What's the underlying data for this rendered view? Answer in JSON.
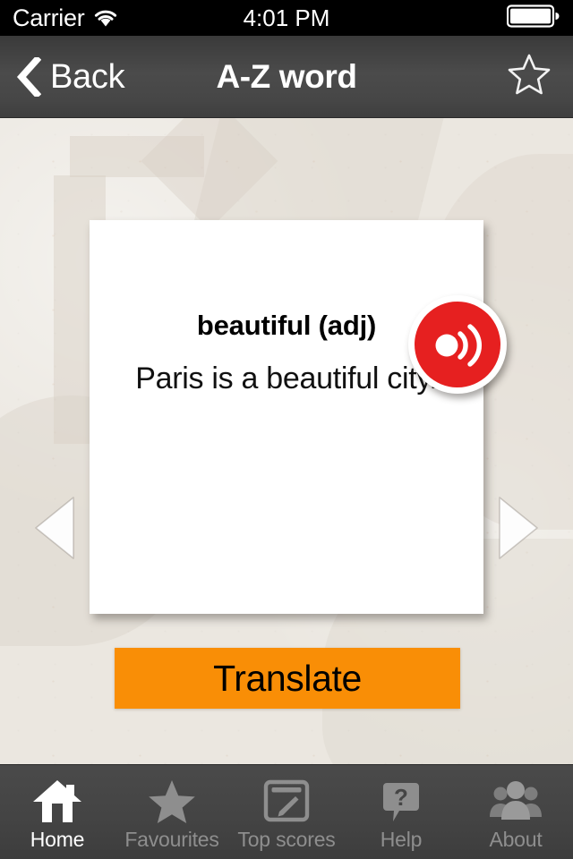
{
  "status_bar": {
    "carrier": "Carrier",
    "wifi_icon": "wifi-icon",
    "time": "4:01 PM",
    "battery_icon": "battery-icon"
  },
  "nav_bar": {
    "back_label": "Back",
    "back_icon": "chevron-left-icon",
    "title": "A-Z word",
    "favourite_icon": "star-outline-icon"
  },
  "card": {
    "word": "beautiful (adj)",
    "sentence": "Paris is a beautiful city."
  },
  "controls": {
    "speaker_icon": "speaker-sound-icon",
    "prev_icon": "triangle-left-icon",
    "next_icon": "triangle-right-icon",
    "translate_label": "Translate"
  },
  "tab_bar": {
    "items": [
      {
        "label": "Home",
        "icon": "home-icon",
        "active": true
      },
      {
        "label": "Favourites",
        "icon": "star-filled-icon",
        "active": false
      },
      {
        "label": "Top scores",
        "icon": "scoreboard-pencil-icon",
        "active": false
      },
      {
        "label": "Help",
        "icon": "question-bubble-icon",
        "active": false
      },
      {
        "label": "About",
        "icon": "people-group-icon",
        "active": false
      }
    ]
  },
  "colors": {
    "accent_orange": "#F98E06",
    "speaker_red": "#E62020",
    "paper_background": "#EBE7E0",
    "chrome_gray": "#444444",
    "tab_inactive": "#8E8E8E",
    "tab_active": "#FFFFFF"
  }
}
